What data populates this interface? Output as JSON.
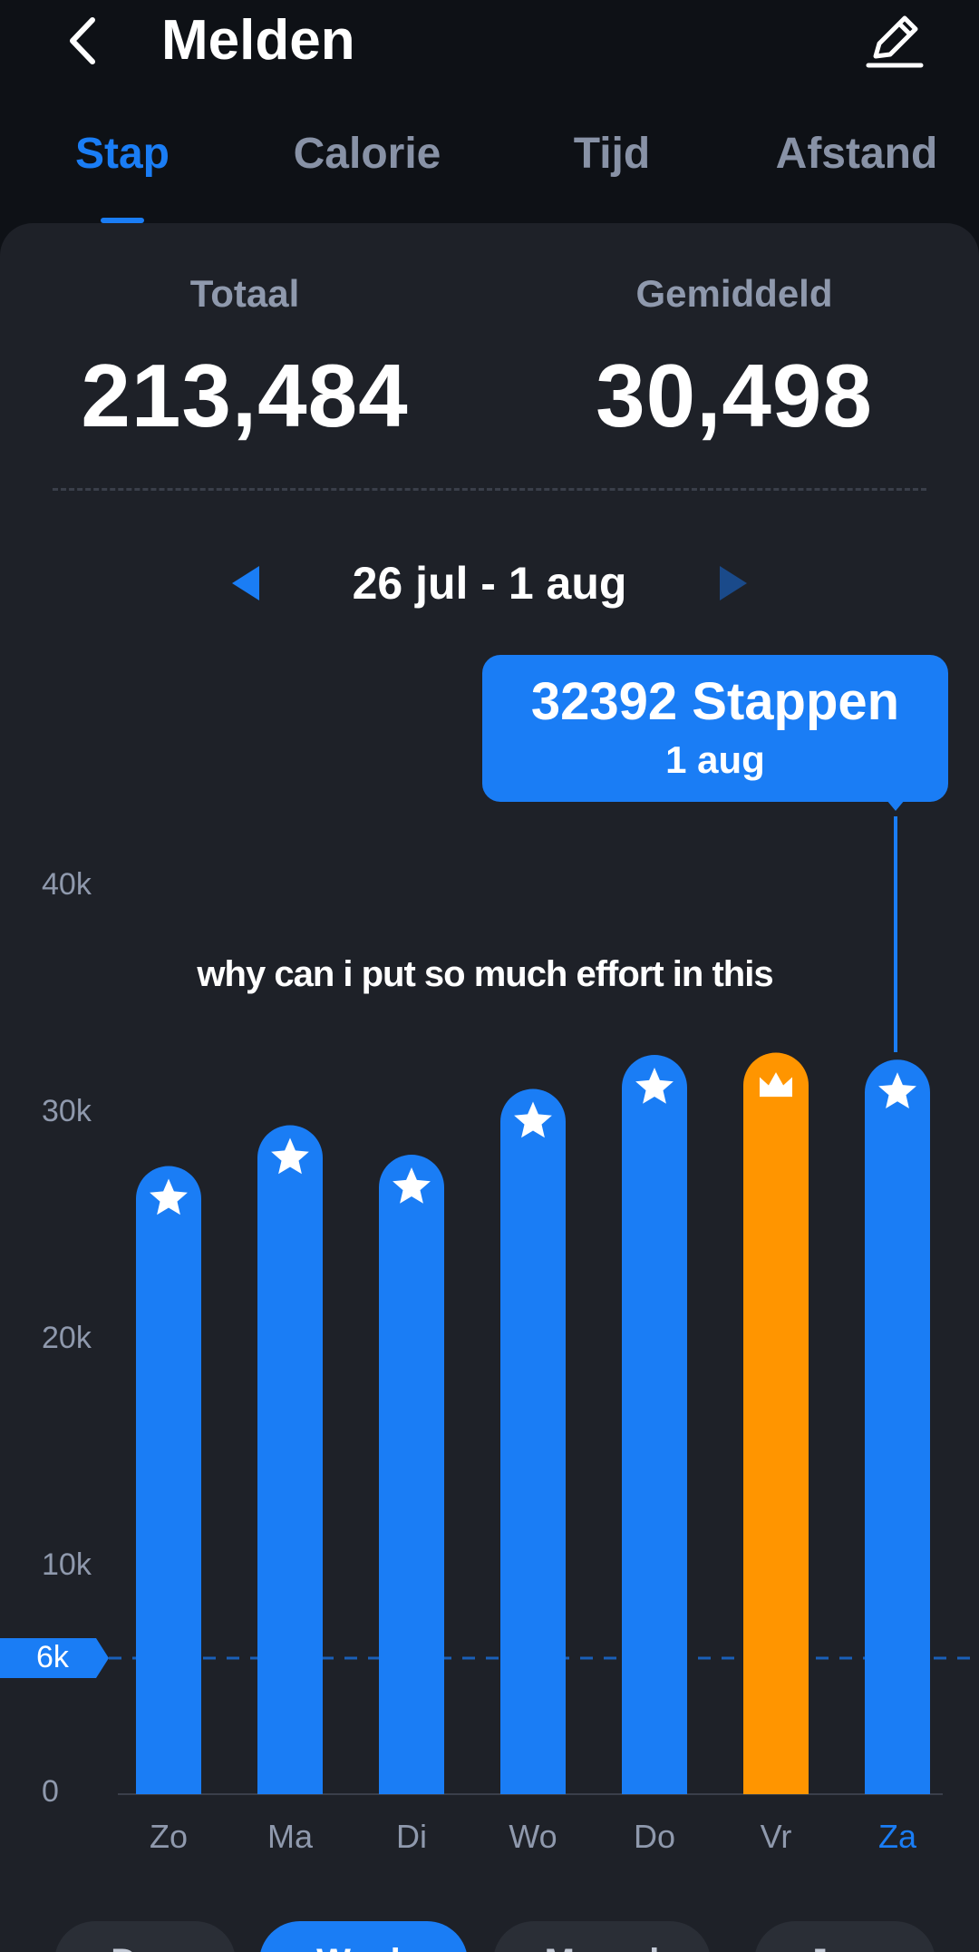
{
  "header": {
    "title": "Melden"
  },
  "tabs": [
    {
      "label": "Stap",
      "active": true
    },
    {
      "label": "Calorie",
      "active": false
    },
    {
      "label": "Tijd",
      "active": false
    },
    {
      "label": "Afstand",
      "active": false
    }
  ],
  "summary": {
    "total_label": "Totaal",
    "total_value": "213,484",
    "average_label": "Gemiddeld",
    "average_value": "30,498"
  },
  "date_range": "26 jul - 1 aug",
  "tooltip": {
    "value": "32392 Stappen",
    "date": "1 aug"
  },
  "caption": "why can i put so much effort in this",
  "goal_label": "6k",
  "colors": {
    "accent": "#1a7df5",
    "best_day": "#ff9500",
    "card": "#1e2128",
    "background": "#0e1116"
  },
  "chart_data": {
    "type": "bar",
    "categories": [
      "Zo",
      "Ma",
      "Di",
      "Wo",
      "Do",
      "Vr",
      "Za"
    ],
    "values": [
      27700,
      29500,
      28200,
      31100,
      32600,
      32700,
      32392
    ],
    "highlight_category": "Vr",
    "selected_category": "Za",
    "y_ticks": [
      0,
      10000,
      20000,
      30000,
      40000
    ],
    "y_tick_labels": [
      "0",
      "10k",
      "20k",
      "30k",
      "40k"
    ],
    "goal": 6000,
    "bar_icons": [
      "star",
      "star",
      "star",
      "star",
      "star",
      "crown",
      "star"
    ],
    "ylim": [
      0,
      40000
    ]
  },
  "period_selector": [
    {
      "label": "Dag",
      "active": false
    },
    {
      "label": "Week",
      "active": true
    },
    {
      "label": "Maand",
      "active": false
    },
    {
      "label": "Jaar",
      "active": false
    }
  ]
}
